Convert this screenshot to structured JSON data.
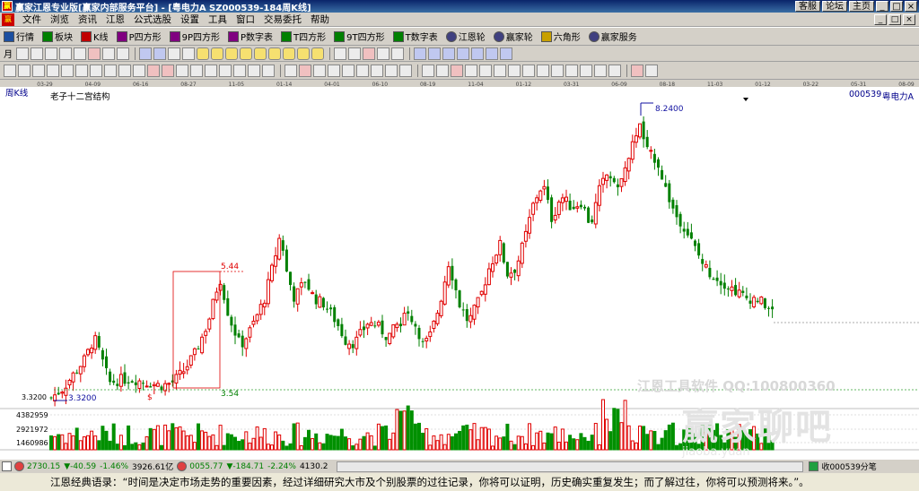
{
  "window": {
    "app_icon": "赢",
    "title": "赢家江恩专业版[赢家内部服务平台] - [粤电力A  SZ000539-184周K线]",
    "buttons": [
      "客服",
      "论坛",
      "主页"
    ],
    "win_controls": [
      "_",
      "□",
      "×"
    ]
  },
  "menubar": {
    "logo": "赢",
    "items": [
      "文件",
      "浏览",
      "资讯",
      "江恩",
      "公式选股",
      "设置",
      "工具",
      "窗口",
      "交易委托",
      "帮助"
    ],
    "controls": [
      "_",
      "□",
      "×"
    ]
  },
  "toolbar": {
    "items": [
      {
        "label": "行情",
        "icon": "grid-icon"
      },
      {
        "label": "板块",
        "icon": "blocks-icon"
      },
      {
        "label": "K线",
        "icon": "kline-icon"
      },
      {
        "label": "P四方形",
        "icon": "square-p-icon"
      },
      {
        "label": "9P四方形",
        "icon": "square-9p-icon"
      },
      {
        "label": "P数字表",
        "icon": "table-p-icon"
      },
      {
        "label": "T四方形",
        "icon": "square-t-icon"
      },
      {
        "label": "9T四方形",
        "icon": "square-9t-icon"
      },
      {
        "label": "T数字表",
        "icon": "table-t-icon"
      },
      {
        "label": "江恩轮",
        "icon": "wheel-icon"
      },
      {
        "label": "赢家轮",
        "icon": "winner-wheel-icon"
      },
      {
        "label": "六角形",
        "icon": "hexagon-icon"
      },
      {
        "label": "赢家服务",
        "icon": "service-icon"
      }
    ],
    "period_label": "月"
  },
  "chart": {
    "panel_title": "周K线",
    "subtitle": "老子十二宫结构",
    "stock_code": "000539",
    "stock_name": "粤电力A",
    "dates": [
      "03-29",
      "04-09",
      "06-16",
      "08-27",
      "11-05",
      "01-14",
      "04-01",
      "06-10",
      "08-19",
      "11-04",
      "01-12",
      "03-31",
      "06-09",
      "08-18",
      "11-03",
      "01-12",
      "03-22",
      "05-31",
      "08-09"
    ],
    "high_label": "8.2400",
    "low_label": "3.3200",
    "left_price": "3.3200",
    "box_top_label": "5.44",
    "box_bottom_label": "3.54",
    "marker": "$",
    "vol_ticks": [
      "4382959",
      "2921972",
      "1460986"
    ],
    "watermark_top": "江恩工具软件  QQ:100800360",
    "watermark_main": "赢家聊吧",
    "watermark_url": "jiaoba.yuan"
  },
  "status": {
    "sh_index": "2730.15",
    "sh_change": "▼-40.59",
    "sh_pct": "-1.46%",
    "sh_vol": "3926.61亿",
    "sz_index": "0055.77",
    "sz_change": "▼-184.71",
    "sz_pct": "-2.24%",
    "sz_vol": "4130.2",
    "right_text": "收000539分笔"
  },
  "quote": {
    "text": "江恩经典语录：“时间是决定市场走势的重要因素，经过详细研究大市及个别股票的过往记录，你将可以证明，历史确实重复发生；而了解过往，你将可以预测将来。”。"
  }
}
